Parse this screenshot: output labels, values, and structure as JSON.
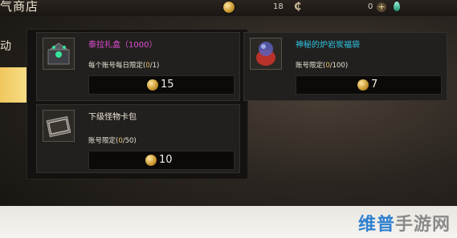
{
  "header": {
    "title": "气商店",
    "currencies": [
      {
        "icon": "gold-coin-icon",
        "value": "18"
      },
      {
        "icon": "c-currency-icon",
        "value": "0"
      },
      {
        "icon": "gem-icon",
        "value": ""
      }
    ]
  },
  "sidebar": {
    "items": [
      {
        "label": "动",
        "active": false
      },
      {
        "label": "",
        "active": true
      }
    ]
  },
  "products": [
    {
      "name": "泰拉礼盒（1000）",
      "name_color": "#e24fd8",
      "limit_prefix": "每个账号每日限定(",
      "limit_count": "0",
      "limit_suffix": "/1)",
      "price": "15",
      "icon": "gift-box-icon"
    },
    {
      "name": "神秘的炉岩炭福袋",
      "name_color": "#2ec7e6",
      "limit_prefix": "账号限定(",
      "limit_count": "0",
      "limit_suffix": "/100)",
      "price": "7",
      "icon": "lucky-bag-icon"
    },
    {
      "name": "下级怪物卡包",
      "name_color": "#efe8da",
      "limit_prefix": "账号限定(",
      "limit_count": "0",
      "limit_suffix": "/50)",
      "price": "10",
      "icon": "card-pack-icon"
    }
  ],
  "watermark": {
    "highlight": "维普",
    "rest": "手游网"
  }
}
